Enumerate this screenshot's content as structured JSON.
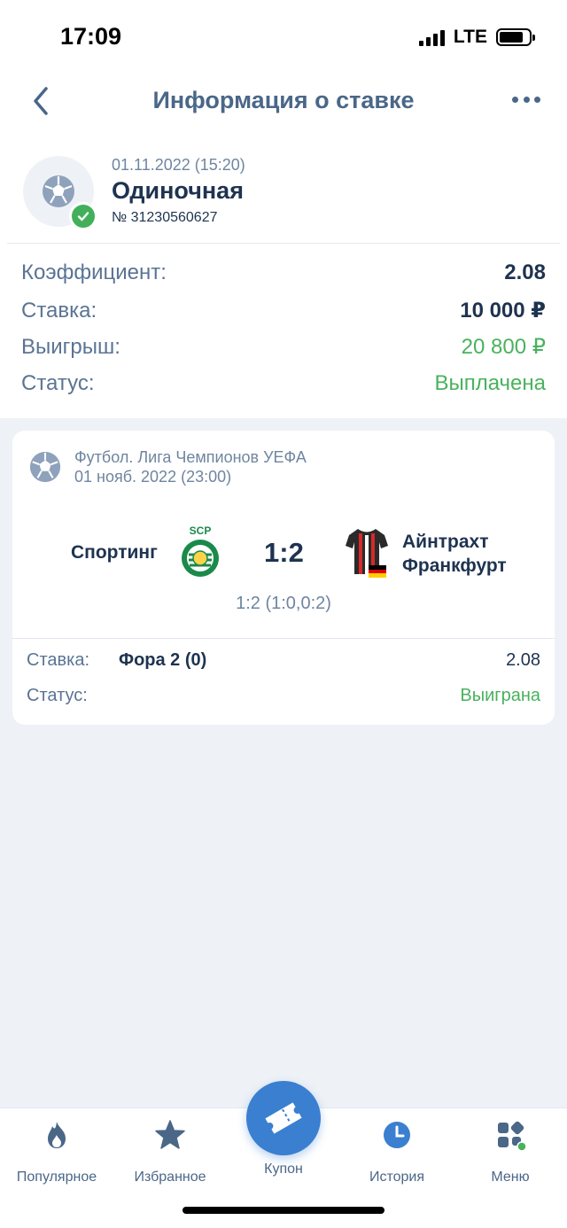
{
  "status_bar": {
    "time": "17:09",
    "network": "LTE"
  },
  "header": {
    "title": "Информация о ставке"
  },
  "bet": {
    "date": "01.11.2022 (15:20)",
    "type": "Одиночная",
    "number": "№ 31230560627"
  },
  "summary": [
    {
      "label": "Коэффициент:",
      "value": "2.08"
    },
    {
      "label": "Ставка:",
      "value": "10 000 ₽"
    },
    {
      "label": "Выигрыш:",
      "value": "20 800 ₽"
    },
    {
      "label": "Статус:",
      "value": "Выплачена"
    }
  ],
  "event": {
    "league": "Футбол. Лига Чемпионов УЕФА",
    "date": "01 нояб. 2022 (23:00)",
    "team1": "Спортинг",
    "team2_line1": "Айнтрахт",
    "team2_line2": "Франкфурт",
    "score": "1:2",
    "partial_score": "1:2 (1:0,0:2)",
    "crest_text": "SCP",
    "selection_label": "Ставка:",
    "selection_value": "Фора 2 (0)",
    "selection_coef": "2.08",
    "status_label": "Статус:",
    "status_value": "Выиграна"
  },
  "nav": [
    {
      "label": "Популярное",
      "icon": "fire-icon"
    },
    {
      "label": "Избранное",
      "icon": "star-icon"
    },
    {
      "label": "Купон",
      "icon": "ticket-icon"
    },
    {
      "label": "История",
      "icon": "clock-icon"
    },
    {
      "label": "Меню",
      "icon": "grid-menu-icon"
    }
  ],
  "colors": {
    "accent": "#3a7fd0",
    "success": "#49b25d",
    "text": "#1e3350",
    "muted": "#6f85a0"
  }
}
